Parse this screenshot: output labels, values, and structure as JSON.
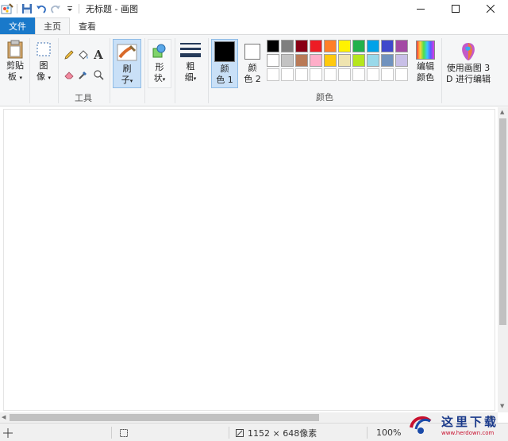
{
  "titlebar": {
    "title": "无标题 - 画图"
  },
  "tabs": {
    "file": "文件",
    "home": "主页",
    "view": "查看"
  },
  "ribbon": {
    "clipboard": {
      "line1": "剪贴",
      "line2": "板"
    },
    "image": {
      "line1": "图",
      "line2": "像"
    },
    "tools_label": "工具",
    "brush": {
      "line1": "刷",
      "line2": "子"
    },
    "shapes": {
      "line1": "形",
      "line2": "状"
    },
    "size": {
      "line1": "粗",
      "line2": "细"
    },
    "color1": {
      "line1": "颜",
      "line2": "色 1"
    },
    "color2": {
      "line1": "颜",
      "line2": "色 2"
    },
    "colors_label": "颜色",
    "edit_colors": {
      "line1": "编辑",
      "line2": "颜色"
    },
    "paint3d": {
      "line1": "使用画图 3",
      "line2": "D 进行编辑"
    },
    "text_tool": "A"
  },
  "palette": {
    "row1": [
      "#000000",
      "#7f7f7f",
      "#880015",
      "#ed1c24",
      "#ff7f27",
      "#fff200",
      "#22b14c",
      "#00a2e8",
      "#3f48cc",
      "#a349a4"
    ],
    "row2": [
      "#ffffff",
      "#c3c3c3",
      "#b97a57",
      "#ffaec9",
      "#ffc90e",
      "#efe4b0",
      "#b5e61d",
      "#99d9ea",
      "#7092be",
      "#c8bfe7"
    ]
  },
  "colors": {
    "accent": "#1979ca",
    "selected_bg": "#c9e0f7",
    "color1": "#000000",
    "color2": "#ffffff"
  },
  "status": {
    "size": "1152 × 648像素",
    "zoom": "100%"
  },
  "watermark": {
    "brand": "这里下载",
    "url": "www.herdown.com"
  }
}
